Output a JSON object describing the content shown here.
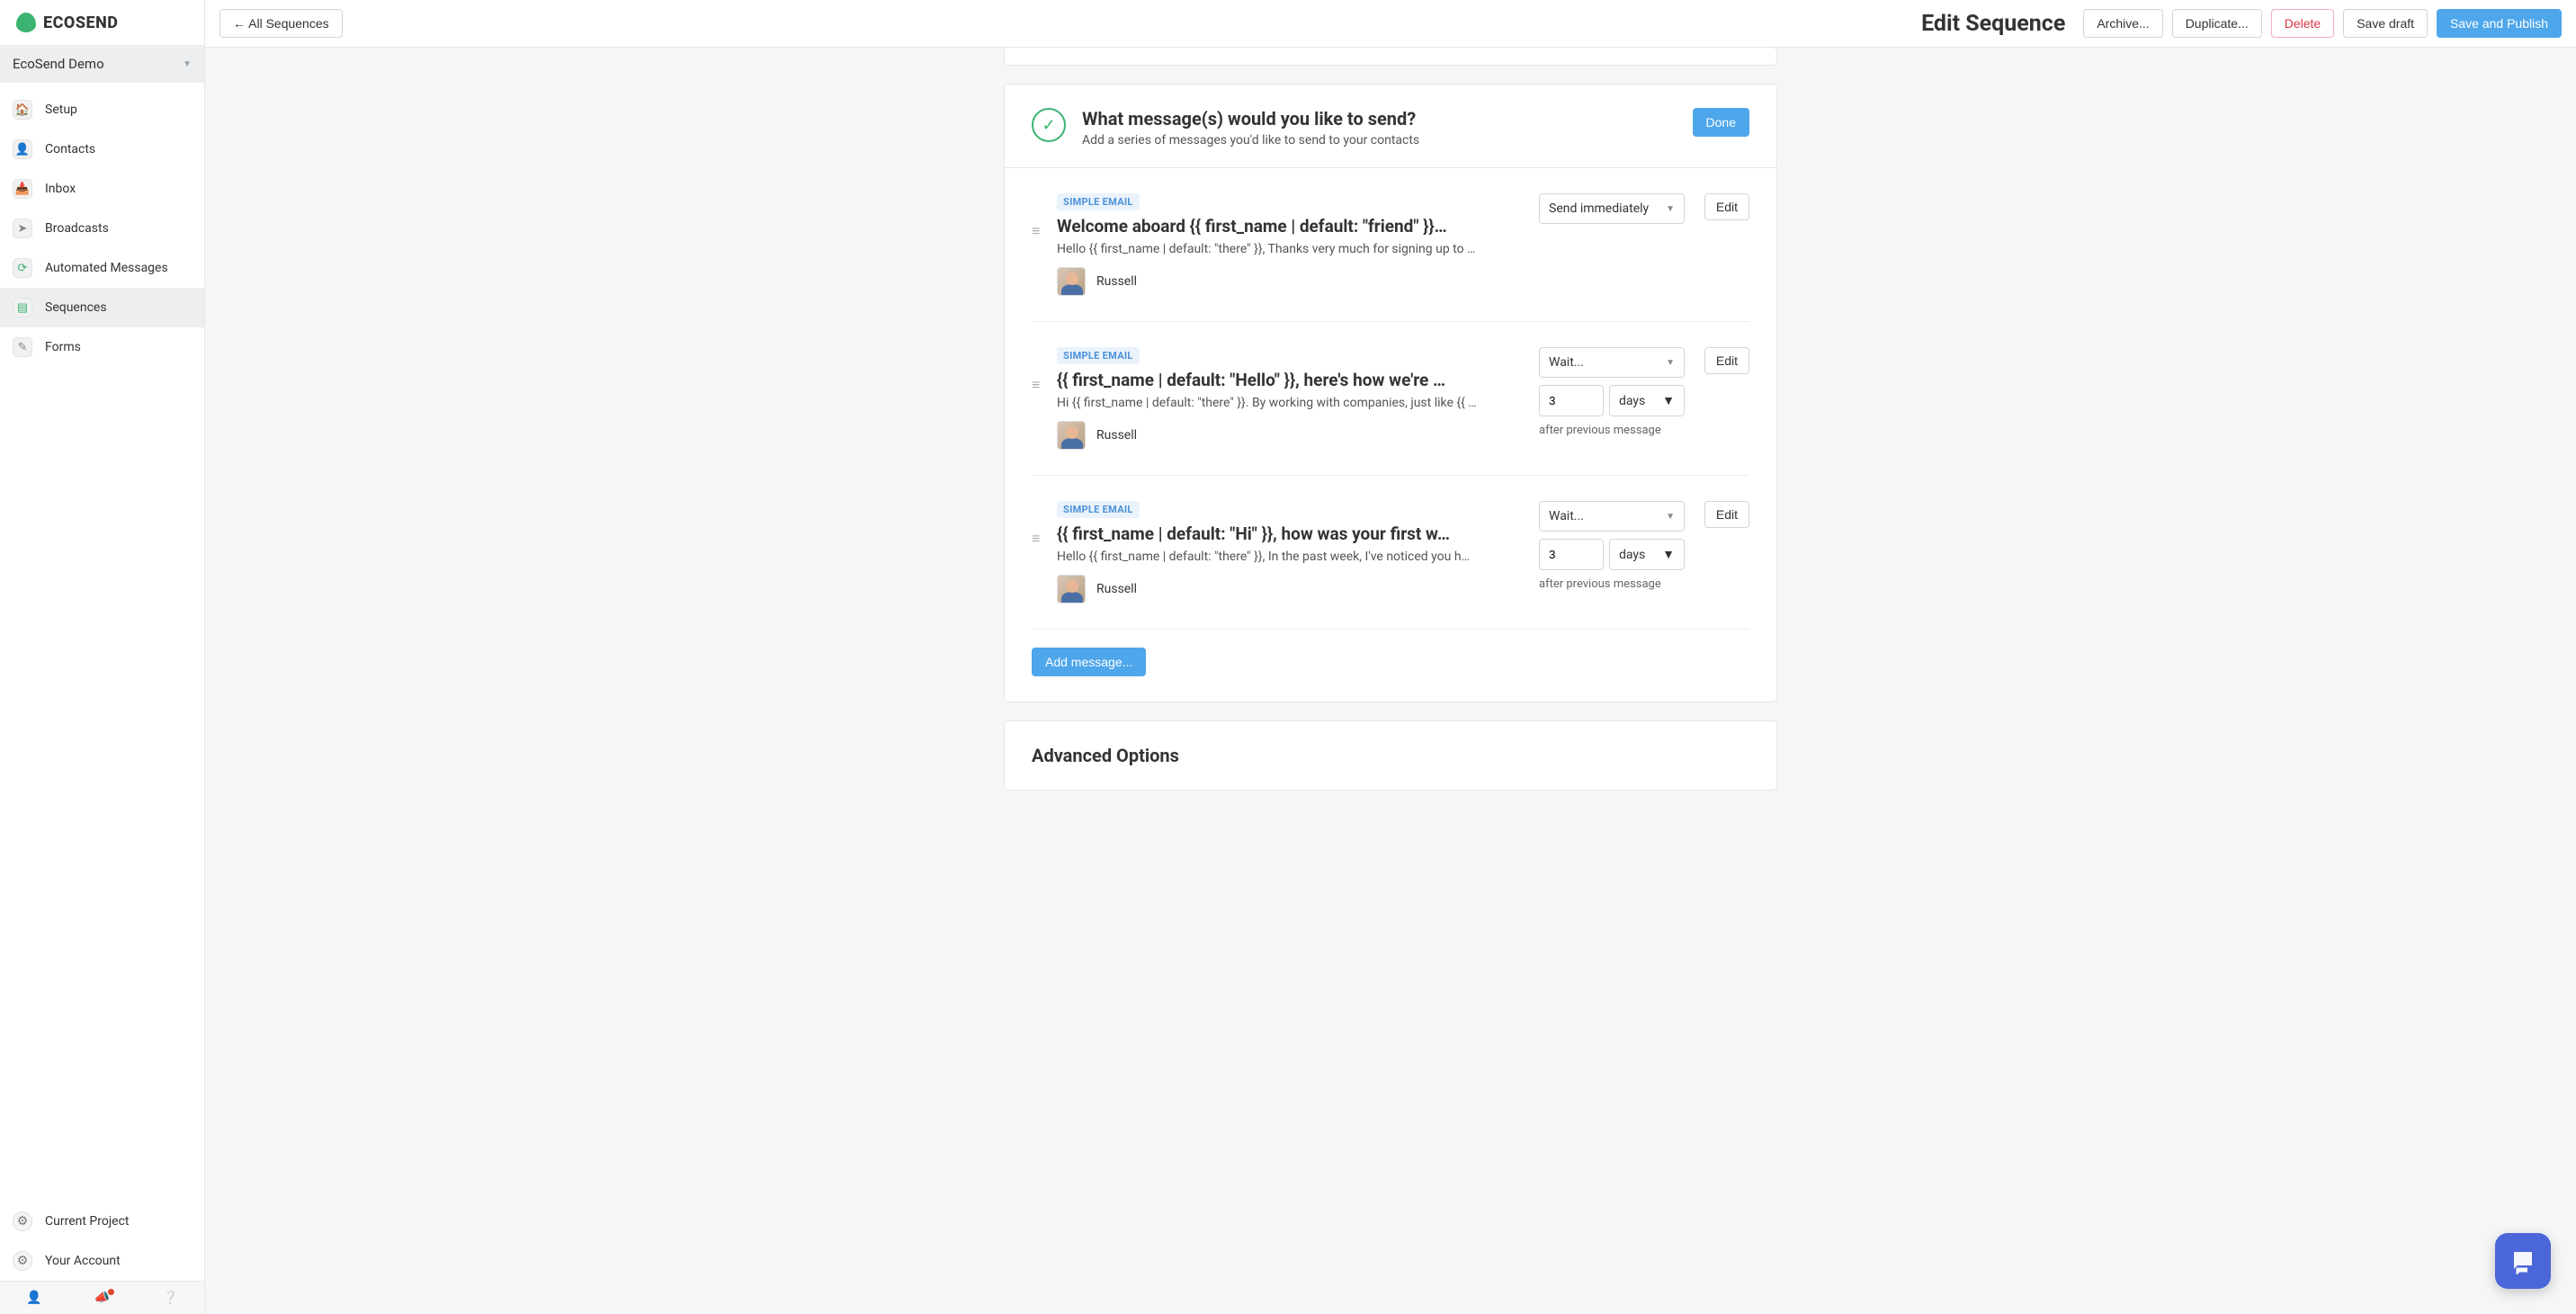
{
  "brand": "ECOSEND",
  "project_name": "EcoSend Demo",
  "sidebar": {
    "items": [
      {
        "label": "Setup"
      },
      {
        "label": "Contacts"
      },
      {
        "label": "Inbox"
      },
      {
        "label": "Broadcasts"
      },
      {
        "label": "Automated Messages"
      },
      {
        "label": "Sequences"
      },
      {
        "label": "Forms"
      }
    ],
    "bottom": [
      {
        "label": "Current Project"
      },
      {
        "label": "Your Account"
      }
    ]
  },
  "topbar": {
    "back_label": "All Sequences",
    "title": "Edit Sequence",
    "archive": "Archive...",
    "duplicate": "Duplicate...",
    "delete": "Delete",
    "save_draft": "Save draft",
    "save_publish": "Save and Publish"
  },
  "section": {
    "title": "What message(s) would you like to send?",
    "subtitle": "Add a series of messages you'd like to send to your contacts",
    "done": "Done"
  },
  "messages": [
    {
      "badge": "SIMPLE EMAIL",
      "title": "Welcome aboard {{ first_name | default: \"friend\" }}…",
      "preview": "Hello {{ first_name | default: \"there\" }}, Thanks very much for signing up to …",
      "sender": "Russell",
      "timing_mode": "Send immediately",
      "wait_amount": "",
      "wait_unit": "",
      "hint": ""
    },
    {
      "badge": "SIMPLE EMAIL",
      "title": "{{ first_name | default: \"Hello\" }}, here's how we're …",
      "preview": "Hi {{ first_name | default: \"there\" }}. By working with companies, just like {{ …",
      "sender": "Russell",
      "timing_mode": "Wait...",
      "wait_amount": "3",
      "wait_unit": "days",
      "hint": "after previous message"
    },
    {
      "badge": "SIMPLE EMAIL",
      "title": "{{ first_name | default: \"Hi\" }}, how was your first w…",
      "preview": "Hello {{ first_name | default: \"there\" }}, In the past week, I've noticed you h…",
      "sender": "Russell",
      "timing_mode": "Wait...",
      "wait_amount": "3",
      "wait_unit": "days",
      "hint": "after previous message"
    }
  ],
  "edit_label": "Edit",
  "add_message": "Add message...",
  "next_section": "Advanced Options"
}
